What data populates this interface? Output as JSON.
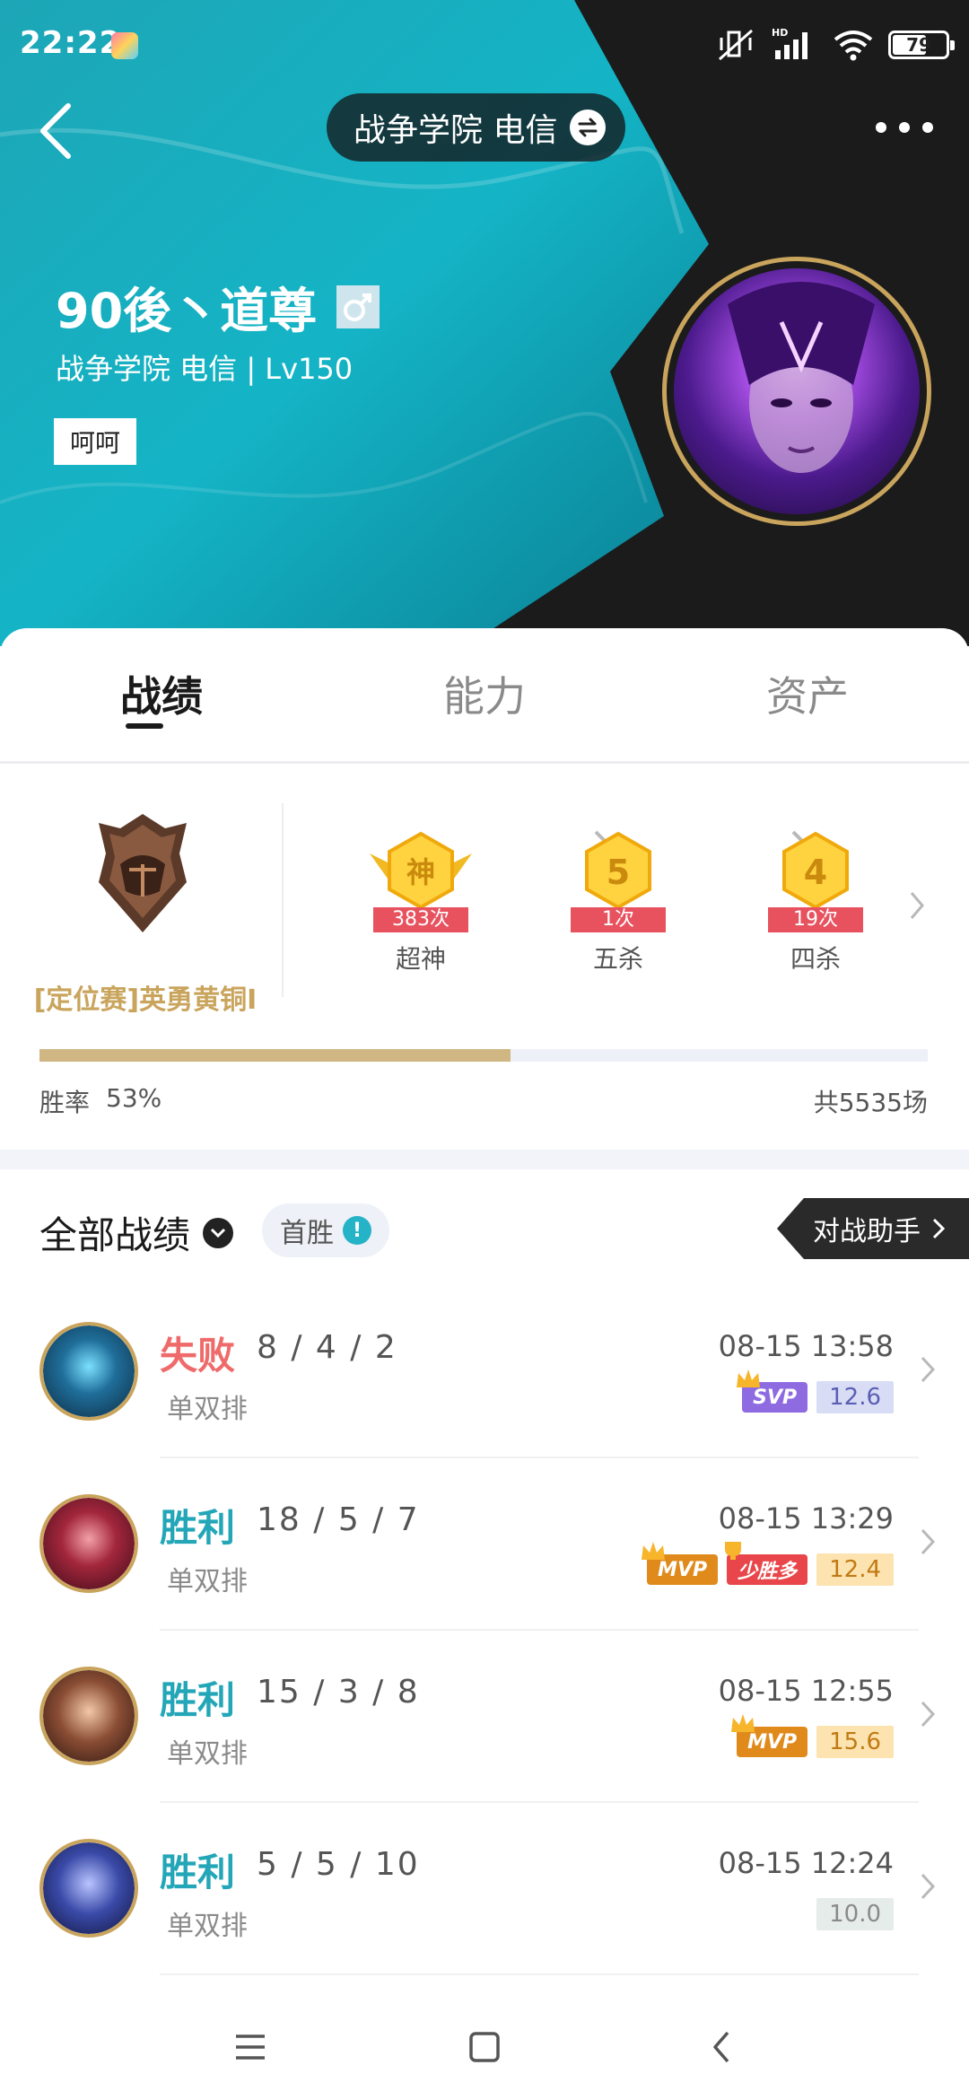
{
  "status": {
    "time": "22:22",
    "battery": "79",
    "network": "HD"
  },
  "header": {
    "server": "战争学院 电信"
  },
  "profile": {
    "name": "90後丶道尊",
    "gender": "♂",
    "subtitle": "战争学院 电信 | Lv150",
    "tag": "呵呵"
  },
  "tabs": [
    {
      "label": "战绩",
      "active": true
    },
    {
      "label": "能力",
      "active": false
    },
    {
      "label": "资产",
      "active": false
    }
  ],
  "summary": {
    "rank_label": "[定位赛]英勇黄铜I",
    "achievements": [
      {
        "glyph": "神",
        "count": "383次",
        "label": "超神"
      },
      {
        "glyph": "5",
        "count": "1次",
        "label": "五杀"
      },
      {
        "glyph": "4",
        "count": "19次",
        "label": "四杀"
      }
    ],
    "winrate_label": "胜率",
    "winrate_value": "53%",
    "winrate_fraction": 0.53,
    "total": "共5535场"
  },
  "matches_header": {
    "title": "全部战绩",
    "first_win": "首胜",
    "assistant": "对战助手"
  },
  "matches": [
    {
      "result": "失败",
      "outcome": "lose",
      "kda": "8 / 4 / 2",
      "mode": "单双排",
      "time": "08-15 13:58",
      "titles": [
        "SVP"
      ],
      "score": "12.6",
      "score_bg": "#d9dcf5",
      "score_color": "#5a5fb3"
    },
    {
      "result": "胜利",
      "outcome": "win",
      "kda": "18 / 5 / 7",
      "mode": "单双排",
      "time": "08-15 13:29",
      "titles": [
        "MVP",
        "少胜多"
      ],
      "score": "12.4",
      "score_bg": "#fde3b0",
      "score_color": "#c07a13"
    },
    {
      "result": "胜利",
      "outcome": "win",
      "kda": "15 / 3 / 8",
      "mode": "单双排",
      "time": "08-15 12:55",
      "titles": [
        "MVP"
      ],
      "score": "15.6",
      "score_bg": "#fde3b0",
      "score_color": "#c07a13"
    },
    {
      "result": "胜利",
      "outcome": "win",
      "kda": "5 / 5 / 10",
      "mode": "单双排",
      "time": "08-15 12:24",
      "titles": [],
      "score": "10.0",
      "score_bg": "#e6ece9",
      "score_color": "#8a8a8a"
    }
  ],
  "colors": {
    "win": "#23a6b7",
    "lose": "#ef6b6b",
    "gold": "#c9a45c"
  }
}
